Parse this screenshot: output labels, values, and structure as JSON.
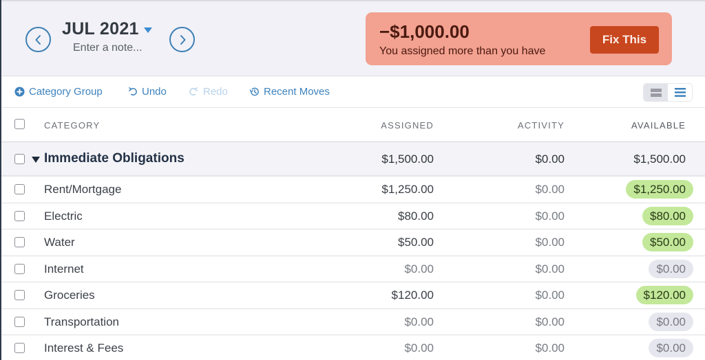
{
  "header": {
    "month": "JUL 2021",
    "note_placeholder": "Enter a note...",
    "prev_month_icon": "chevron-left-circle-icon",
    "next_month_icon": "chevron-right-circle-icon"
  },
  "alert": {
    "amount": "−$1,000.00",
    "message": "You assigned more than you have",
    "button_label": "Fix This",
    "background_color": "#f3a190",
    "button_color": "#c9471e"
  },
  "toolbar": {
    "add_group_label": "Category Group",
    "undo_label": "Undo",
    "redo_label": "Redo",
    "recent_moves_label": "Recent Moves",
    "redo_disabled": true,
    "view_modes": [
      "compact",
      "list"
    ],
    "active_view": "list"
  },
  "table": {
    "columns": {
      "category": "CATEGORY",
      "assigned": "ASSIGNED",
      "activity": "ACTIVITY",
      "available": "AVAILABLE"
    },
    "group": {
      "name": "Immediate Obligations",
      "assigned": "$1,500.00",
      "activity": "$0.00",
      "available": "$1,500.00",
      "expanded": true
    },
    "categories": [
      {
        "name": "Rent/Mortgage",
        "assigned": "$1,250.00",
        "activity": "$0.00",
        "available": "$1,250.00",
        "status": "funded"
      },
      {
        "name": "Electric",
        "assigned": "$80.00",
        "activity": "$0.00",
        "available": "$80.00",
        "status": "funded"
      },
      {
        "name": "Water",
        "assigned": "$50.00",
        "activity": "$0.00",
        "available": "$50.00",
        "status": "funded"
      },
      {
        "name": "Internet",
        "assigned": "$0.00",
        "activity": "$0.00",
        "available": "$0.00",
        "status": "zero"
      },
      {
        "name": "Groceries",
        "assigned": "$120.00",
        "activity": "$0.00",
        "available": "$120.00",
        "status": "funded"
      },
      {
        "name": "Transportation",
        "assigned": "$0.00",
        "activity": "$0.00",
        "available": "$0.00",
        "status": "zero"
      },
      {
        "name": "Interest & Fees",
        "assigned": "$0.00",
        "activity": "$0.00",
        "available": "$0.00",
        "status": "zero"
      }
    ],
    "colors": {
      "funded_pill": "#c3e89a",
      "zero_pill": "#e6e6ee",
      "accent": "#3d82bd"
    }
  }
}
